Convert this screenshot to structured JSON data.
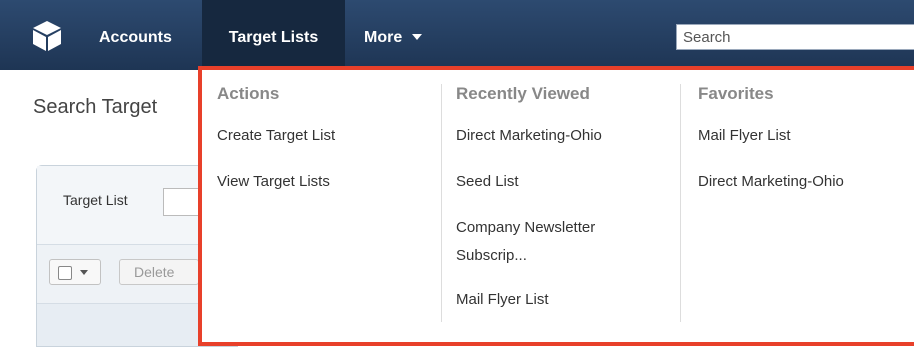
{
  "nav": {
    "logo_icon": "cube-logo-icon",
    "accounts": "Accounts",
    "target_lists": "Target Lists",
    "more": "More",
    "search_placeholder": "Search"
  },
  "page": {
    "title": "Search Target",
    "filter_label": "Target List",
    "delete_label": "Delete"
  },
  "menu": {
    "actions": {
      "heading": "Actions",
      "items": [
        "Create Target List",
        "View Target Lists"
      ]
    },
    "recent": {
      "heading": "Recently Viewed",
      "items": [
        "Direct Marketing-Ohio",
        "Seed List",
        "Company Newsletter",
        "Subscrip...",
        "Mail Flyer List"
      ]
    },
    "favorites": {
      "heading": "Favorites",
      "items": [
        "Mail Flyer List",
        "Direct Marketing-Ohio"
      ]
    }
  },
  "colors": {
    "nav_bg": "#2d4a70",
    "active_tab": "#16283f",
    "highlight_border": "#e8402a"
  }
}
